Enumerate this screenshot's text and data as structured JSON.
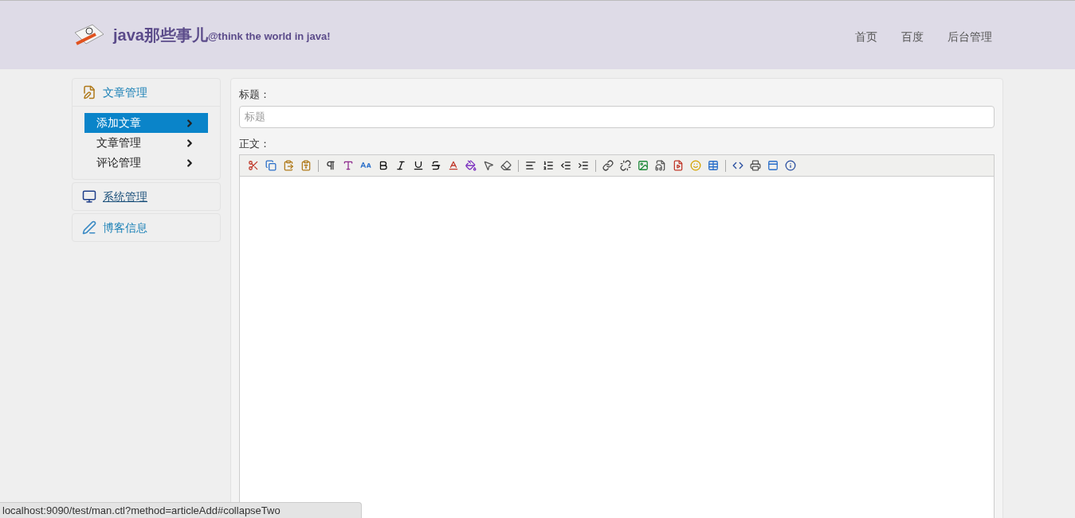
{
  "header": {
    "brand": "java那些事儿",
    "tagline": "@think the world in java!",
    "nav": [
      {
        "label": "首页"
      },
      {
        "label": "百度"
      },
      {
        "label": "后台管理"
      }
    ]
  },
  "sidebar": {
    "groups": [
      {
        "title": "文章管理",
        "kind": "article",
        "expanded": true,
        "hovered": false,
        "items": [
          {
            "label": "添加文章",
            "selected": true
          },
          {
            "label": "文章管理",
            "selected": false
          },
          {
            "label": "评论管理",
            "selected": false
          }
        ]
      },
      {
        "title": "系统管理",
        "kind": "system",
        "expanded": false,
        "hovered": true
      },
      {
        "title": "博客信息",
        "kind": "info",
        "expanded": false,
        "hovered": false
      }
    ]
  },
  "form": {
    "title_label": "标题：",
    "title_field": {
      "placeholder": "标题"
    },
    "body_label": "正文："
  },
  "status_bar": {
    "url": "localhost:9090/test/man.ctl?method=articleAdd#collapseTwo"
  }
}
